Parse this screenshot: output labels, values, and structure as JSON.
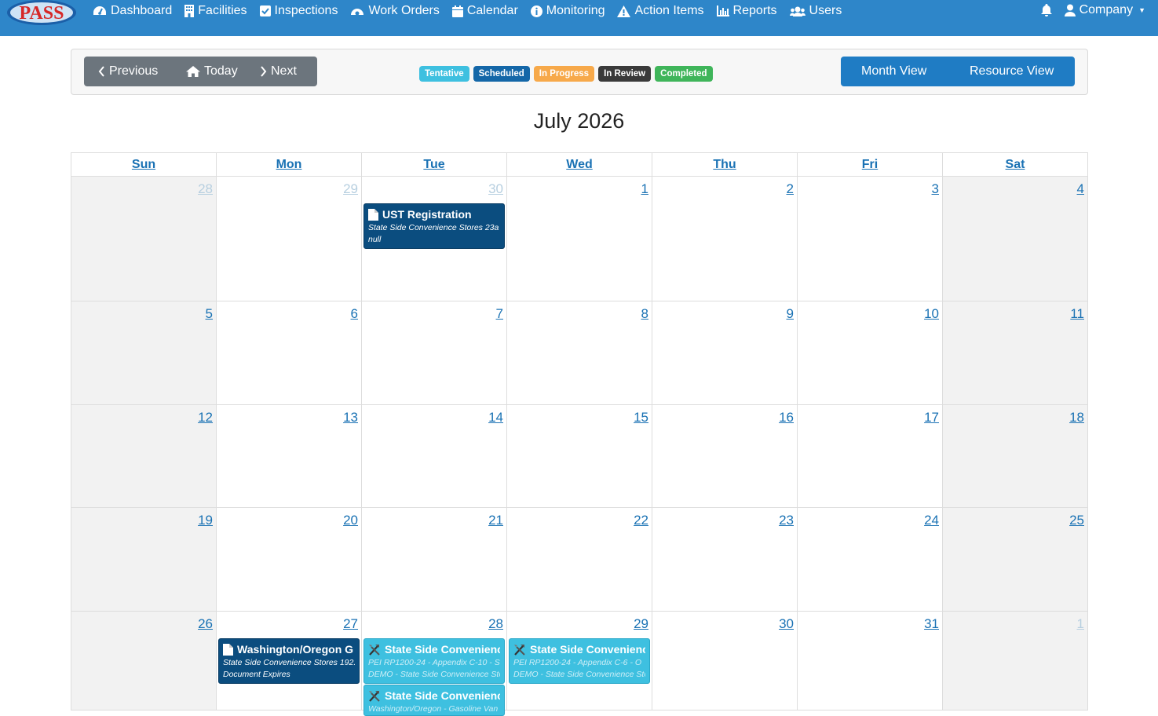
{
  "brand": {
    "logo_text": "PASS"
  },
  "nav": {
    "items": [
      {
        "label": "Dashboard",
        "icon": "dashboard-icon"
      },
      {
        "label": "Facilities",
        "icon": "building-icon"
      },
      {
        "label": "Inspections",
        "icon": "checkbox-icon"
      },
      {
        "label": "Work Orders",
        "icon": "work-orders-icon"
      },
      {
        "label": "Calendar",
        "icon": "calendar-icon"
      },
      {
        "label": "Monitoring",
        "icon": "info-icon"
      },
      {
        "label": "Action Items",
        "icon": "warning-icon"
      },
      {
        "label": "Reports",
        "icon": "bar-chart-icon"
      },
      {
        "label": "Users",
        "icon": "users-icon"
      }
    ],
    "company_label": "Company"
  },
  "toolbar": {
    "previous_label": "Previous",
    "today_label": "Today",
    "next_label": "Next",
    "month_view_label": "Month View",
    "resource_view_label": "Resource View"
  },
  "legend": {
    "tentative": "Tentative",
    "scheduled": "Scheduled",
    "in_progress": "In Progress",
    "in_review": "In Review",
    "completed": "Completed"
  },
  "colors": {
    "navbar": "#2e86c9",
    "tentative": "#3ec0e0",
    "scheduled": "#1467a8",
    "in_progress": "#f7a94a",
    "in_review": "#3a3a3a",
    "completed": "#3fb55a"
  },
  "calendar": {
    "title": "July 2026",
    "weekdays": [
      "Sun",
      "Mon",
      "Tue",
      "Wed",
      "Thu",
      "Fri",
      "Sat"
    ],
    "weeks": [
      [
        "28",
        "29",
        "30",
        "1",
        "2",
        "3",
        "4"
      ],
      [
        "5",
        "6",
        "7",
        "8",
        "9",
        "10",
        "11"
      ],
      [
        "12",
        "13",
        "14",
        "15",
        "16",
        "17",
        "18"
      ],
      [
        "19",
        "20",
        "21",
        "22",
        "23",
        "24",
        "25"
      ],
      [
        "26",
        "27",
        "28",
        "29",
        "30",
        "31",
        "1"
      ]
    ],
    "events": {
      "ust": {
        "title": "UST Registration",
        "line1": "State Side Convenience Stores 23a",
        "line2": "null",
        "icon": "document-icon"
      },
      "wa": {
        "title": "Washington/Oregon G",
        "line1": "State Side Convenience Stores 192.",
        "line2": "Document Expires",
        "icon": "document-icon"
      },
      "ss1": {
        "title": "State Side Convenienc",
        "line1": "PEI RP1200-24 - Appendix C-10 - S",
        "line2": "DEMO - State Side Convenience Sto",
        "icon": "tools-icon"
      },
      "ss2": {
        "title": "State Side Convenienc",
        "line1": "PEI RP1200-24 - Appendix C-6 - O",
        "line2": "DEMO - State Side Convenience Sto",
        "icon": "tools-icon"
      },
      "ss3": {
        "title": "State Side Convenienc",
        "line1": "Washington/Oregon - Gasoline Van",
        "icon": "tools-icon"
      }
    }
  }
}
